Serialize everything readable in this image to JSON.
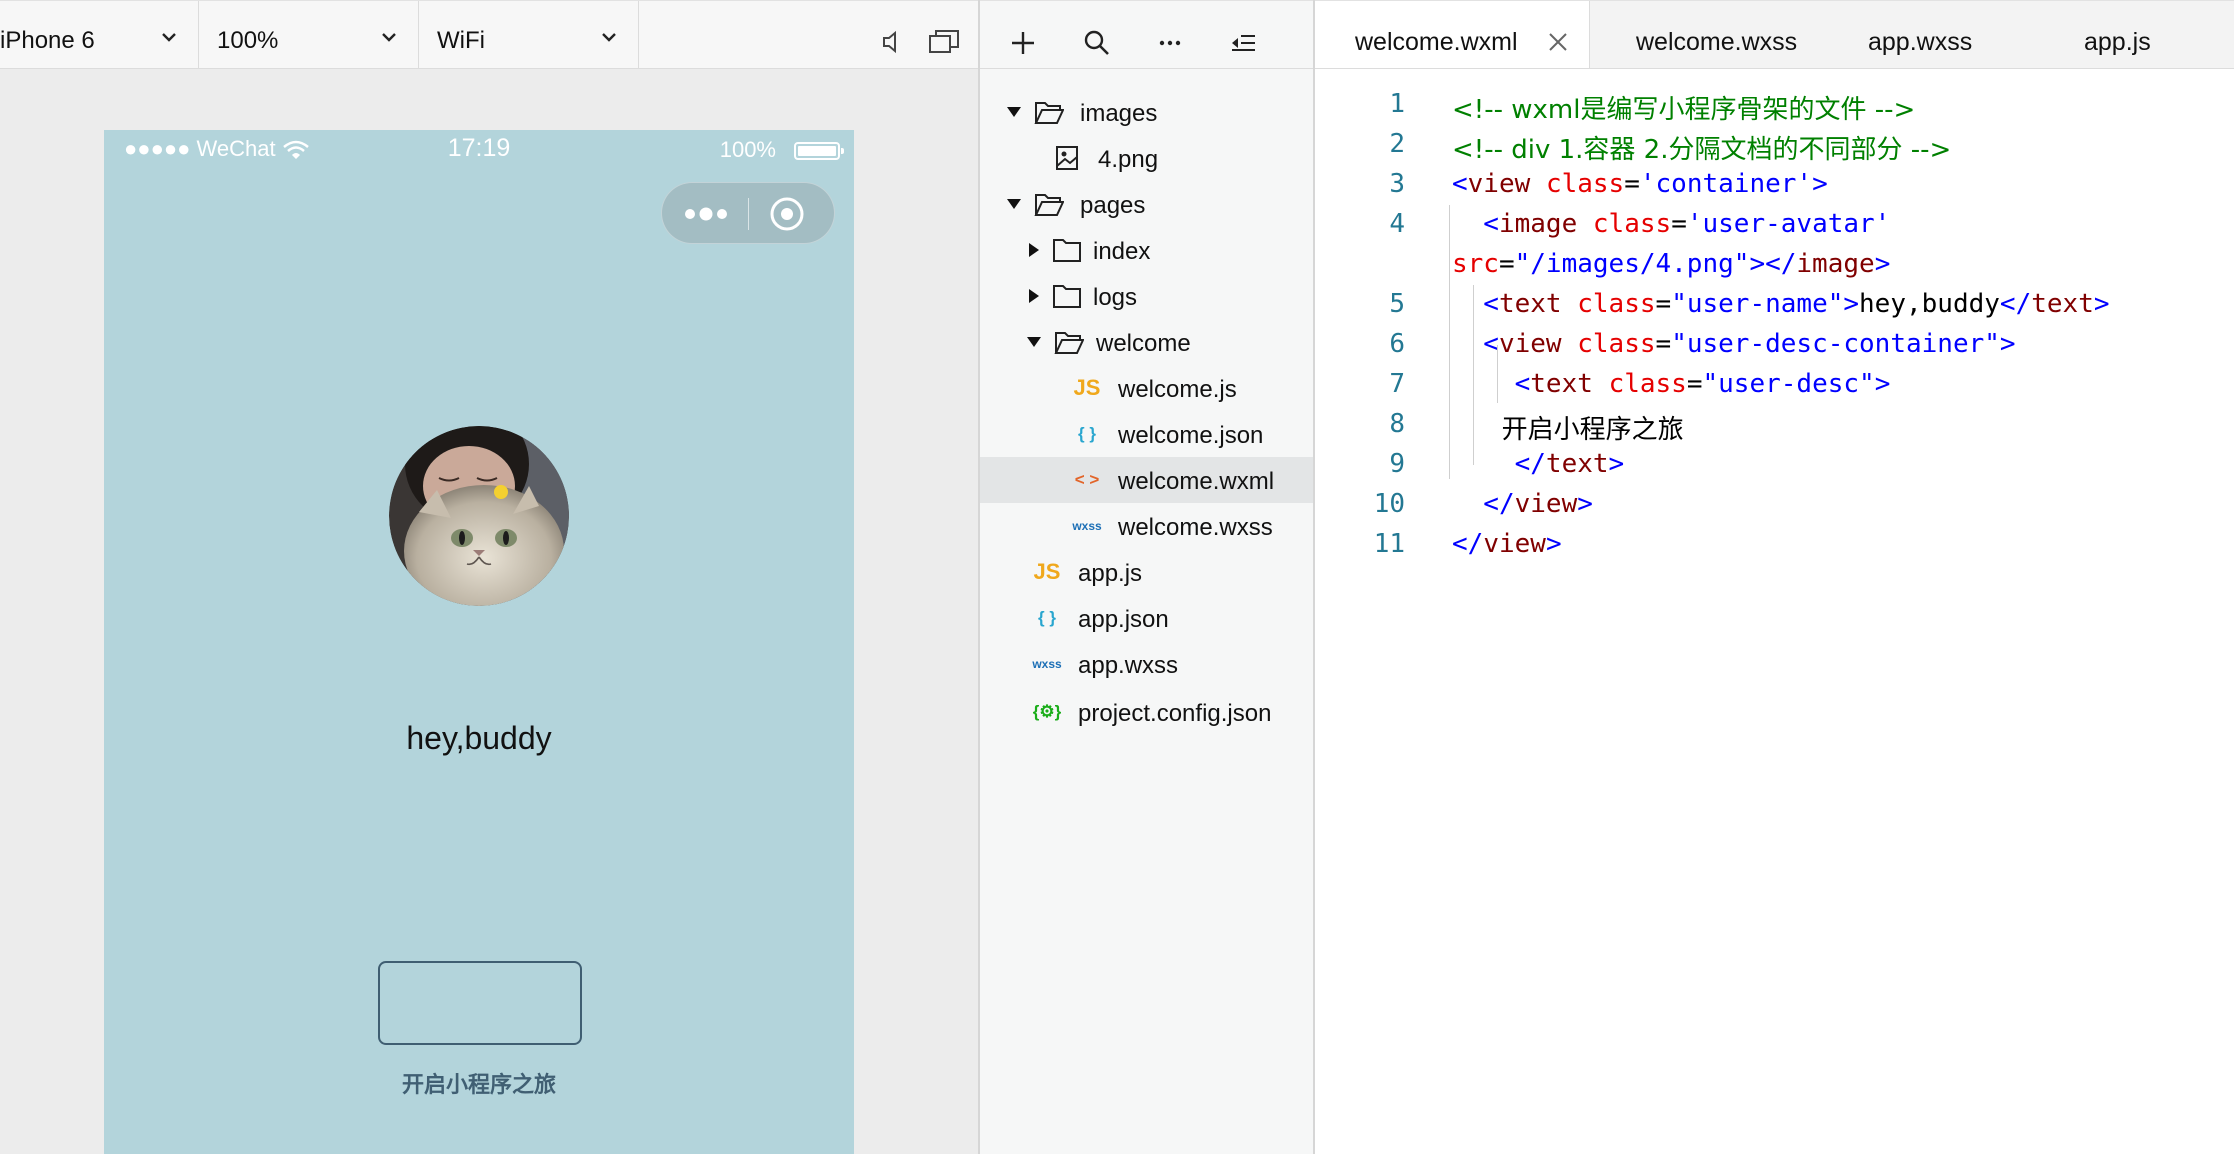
{
  "simulator_toolbar": {
    "device": "iPhone 6",
    "zoom": "100%",
    "network": "WiFi",
    "icons": [
      "speaker-icon",
      "window-icon"
    ]
  },
  "phone": {
    "status_bar": {
      "carrier": "●●●●● WeChat",
      "time": "17:19",
      "battery": "100%"
    },
    "capsule_icons": [
      "more-dots-icon",
      "close-ring-icon"
    ],
    "user_name": "hey,buddy",
    "user_desc": "开启小程序之旅"
  },
  "file_toolbar": {
    "icons": [
      "add-icon",
      "search-icon",
      "more-icon",
      "collapse-icon"
    ]
  },
  "file_tree": [
    {
      "label": "images",
      "type": "folder",
      "expanded": true
    },
    {
      "label": "4.png",
      "type": "image"
    },
    {
      "label": "pages",
      "type": "folder",
      "expanded": true
    },
    {
      "label": "index",
      "type": "folder",
      "expanded": false
    },
    {
      "label": "logs",
      "type": "folder",
      "expanded": false
    },
    {
      "label": "welcome",
      "type": "folder",
      "expanded": true
    },
    {
      "label": "welcome.js",
      "type": "js",
      "icon_text": "JS"
    },
    {
      "label": "welcome.json",
      "type": "json",
      "icon_text": "{ }"
    },
    {
      "label": "welcome.wxml",
      "type": "wxml",
      "icon_text": "< >",
      "selected": true
    },
    {
      "label": "welcome.wxss",
      "type": "wxss",
      "icon_text": "wxss"
    },
    {
      "label": "app.js",
      "type": "js",
      "icon_text": "JS"
    },
    {
      "label": "app.json",
      "type": "json",
      "icon_text": "{ }"
    },
    {
      "label": "app.wxss",
      "type": "wxss",
      "icon_text": "wxss"
    },
    {
      "label": "project.config.json",
      "type": "config",
      "icon_text": "{⚙}"
    }
  ],
  "editor": {
    "tabs": [
      {
        "label": "welcome.wxml",
        "active": true
      },
      {
        "label": "welcome.wxss"
      },
      {
        "label": "app.wxss"
      },
      {
        "label": "app.js"
      }
    ],
    "line_numbers": [
      "1",
      "2",
      "3",
      "4",
      "",
      "5",
      "6",
      "7",
      "8",
      "9",
      "10",
      "11"
    ],
    "code_lines": [
      [
        {
          "t": "<!-- wxml是编写小程序骨架的文件 -->",
          "c": "com"
        }
      ],
      [
        {
          "t": "<!-- div 1.容器 2.分隔文档的不同部分 -->",
          "c": "com"
        }
      ],
      [
        {
          "t": "<",
          "c": "pun"
        },
        {
          "t": "view",
          "c": "tag"
        },
        {
          "t": " ",
          "c": "txt"
        },
        {
          "t": "class",
          "c": "attr"
        },
        {
          "t": "=",
          "c": "txt"
        },
        {
          "t": "'container'",
          "c": "str"
        },
        {
          "t": ">",
          "c": "pun"
        }
      ],
      [
        {
          "t": "  <",
          "c": "pun"
        },
        {
          "t": "image",
          "c": "tag"
        },
        {
          "t": " ",
          "c": "txt"
        },
        {
          "t": "class",
          "c": "attr"
        },
        {
          "t": "=",
          "c": "txt"
        },
        {
          "t": "'user-avatar'",
          "c": "str"
        }
      ],
      [
        {
          "t": "src",
          "c": "attr"
        },
        {
          "t": "=",
          "c": "txt"
        },
        {
          "t": "\"/images/4.png\"",
          "c": "str"
        },
        {
          "t": "></",
          "c": "pun"
        },
        {
          "t": "image",
          "c": "tag"
        },
        {
          "t": ">",
          "c": "pun"
        }
      ],
      [
        {
          "t": "  <",
          "c": "pun"
        },
        {
          "t": "text",
          "c": "tag"
        },
        {
          "t": " ",
          "c": "txt"
        },
        {
          "t": "class",
          "c": "attr"
        },
        {
          "t": "=",
          "c": "txt"
        },
        {
          "t": "\"user-name\"",
          "c": "str"
        },
        {
          "t": ">",
          "c": "pun"
        },
        {
          "t": "hey,buddy",
          "c": "txt"
        },
        {
          "t": "</",
          "c": "pun"
        },
        {
          "t": "text",
          "c": "tag"
        },
        {
          "t": ">",
          "c": "pun"
        }
      ],
      [
        {
          "t": "  <",
          "c": "pun"
        },
        {
          "t": "view",
          "c": "tag"
        },
        {
          "t": " ",
          "c": "txt"
        },
        {
          "t": "class",
          "c": "attr"
        },
        {
          "t": "=",
          "c": "txt"
        },
        {
          "t": "\"user-desc-container\"",
          "c": "str"
        },
        {
          "t": ">",
          "c": "pun"
        }
      ],
      [
        {
          "t": "    <",
          "c": "pun"
        },
        {
          "t": "text",
          "c": "tag"
        },
        {
          "t": " ",
          "c": "txt"
        },
        {
          "t": "class",
          "c": "attr"
        },
        {
          "t": "=",
          "c": "txt"
        },
        {
          "t": "\"user-desc\"",
          "c": "str"
        },
        {
          "t": ">",
          "c": "pun"
        }
      ],
      [
        {
          "t": "      开启小程序之旅",
          "c": "txt"
        }
      ],
      [
        {
          "t": "    </",
          "c": "pun"
        },
        {
          "t": "text",
          "c": "tag"
        },
        {
          "t": ">",
          "c": "pun"
        }
      ],
      [
        {
          "t": "  </",
          "c": "pun"
        },
        {
          "t": "view",
          "c": "tag"
        },
        {
          "t": ">",
          "c": "pun"
        }
      ],
      [
        {
          "t": "</",
          "c": "pun"
        },
        {
          "t": "view",
          "c": "tag"
        },
        {
          "t": ">",
          "c": "pun"
        }
      ]
    ]
  },
  "colors": {
    "phone_background": "#b3d4db",
    "comment": "#008000",
    "tag": "#800000",
    "attribute": "#e50000",
    "string": "#0000ff",
    "line_number": "#237893"
  }
}
